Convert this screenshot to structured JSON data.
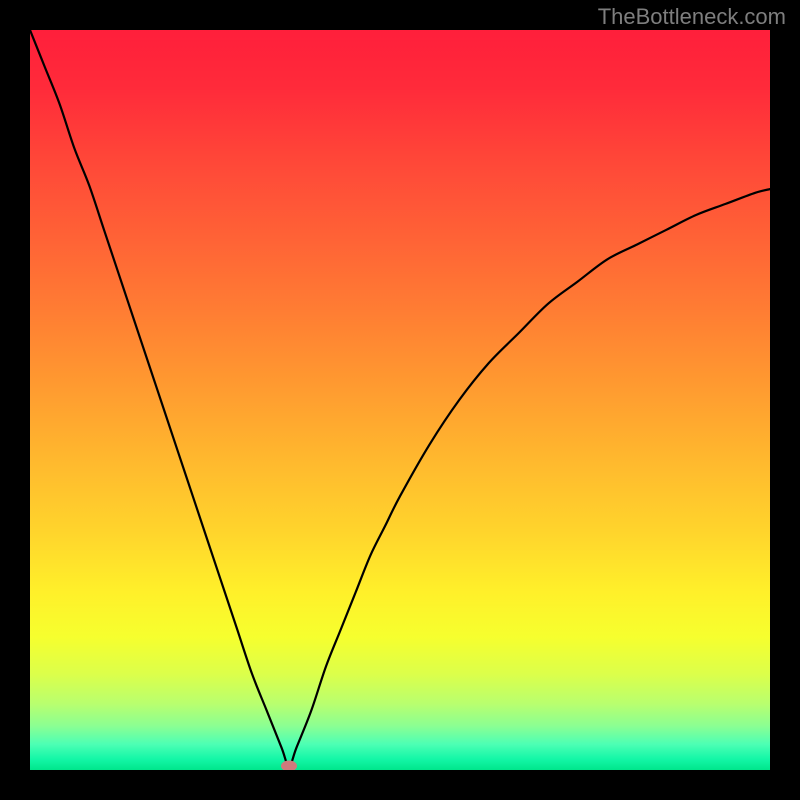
{
  "watermark": {
    "text": "TheBottleneck.com"
  },
  "chart_data": {
    "type": "line",
    "title": "",
    "xlabel": "",
    "ylabel": "",
    "xlim": [
      0,
      100
    ],
    "ylim": [
      0,
      100
    ],
    "grid": false,
    "curve_description": "Single black curve resembling a bottleneck/V shape: steep descent from top-left, sharp minimum near x≈35, then rises and flattens toward upper-right.",
    "series": [
      {
        "name": "curve",
        "x": [
          0,
          2,
          4,
          6,
          8,
          10,
          12,
          14,
          16,
          18,
          20,
          22,
          24,
          26,
          28,
          30,
          32,
          34,
          35,
          36,
          38,
          40,
          42,
          44,
          46,
          48,
          50,
          54,
          58,
          62,
          66,
          70,
          74,
          78,
          82,
          86,
          90,
          94,
          98,
          100
        ],
        "y": [
          100,
          95,
          90,
          84,
          79,
          73,
          67,
          61,
          55,
          49,
          43,
          37,
          31,
          25,
          19,
          13,
          8,
          3,
          0.5,
          3,
          8,
          14,
          19,
          24,
          29,
          33,
          37,
          44,
          50,
          55,
          59,
          63,
          66,
          69,
          71,
          73,
          75,
          76.5,
          78,
          78.5
        ]
      }
    ],
    "marker": {
      "x": 35,
      "y": 0.5,
      "color": "#cf7a7c"
    },
    "background_gradient": {
      "stops": [
        {
          "offset": 0.0,
          "color": "#ff1f3b"
        },
        {
          "offset": 0.08,
          "color": "#ff2b3a"
        },
        {
          "offset": 0.18,
          "color": "#ff4838"
        },
        {
          "offset": 0.28,
          "color": "#ff6236"
        },
        {
          "offset": 0.38,
          "color": "#ff7d33"
        },
        {
          "offset": 0.48,
          "color": "#ff9a30"
        },
        {
          "offset": 0.58,
          "color": "#ffb82e"
        },
        {
          "offset": 0.68,
          "color": "#ffd52c"
        },
        {
          "offset": 0.76,
          "color": "#fff02a"
        },
        {
          "offset": 0.82,
          "color": "#f6ff2e"
        },
        {
          "offset": 0.87,
          "color": "#dcff4a"
        },
        {
          "offset": 0.91,
          "color": "#b9ff6e"
        },
        {
          "offset": 0.94,
          "color": "#8cff92"
        },
        {
          "offset": 0.965,
          "color": "#4dffb4"
        },
        {
          "offset": 0.985,
          "color": "#14f7a7"
        },
        {
          "offset": 1.0,
          "color": "#00e68b"
        }
      ]
    }
  }
}
